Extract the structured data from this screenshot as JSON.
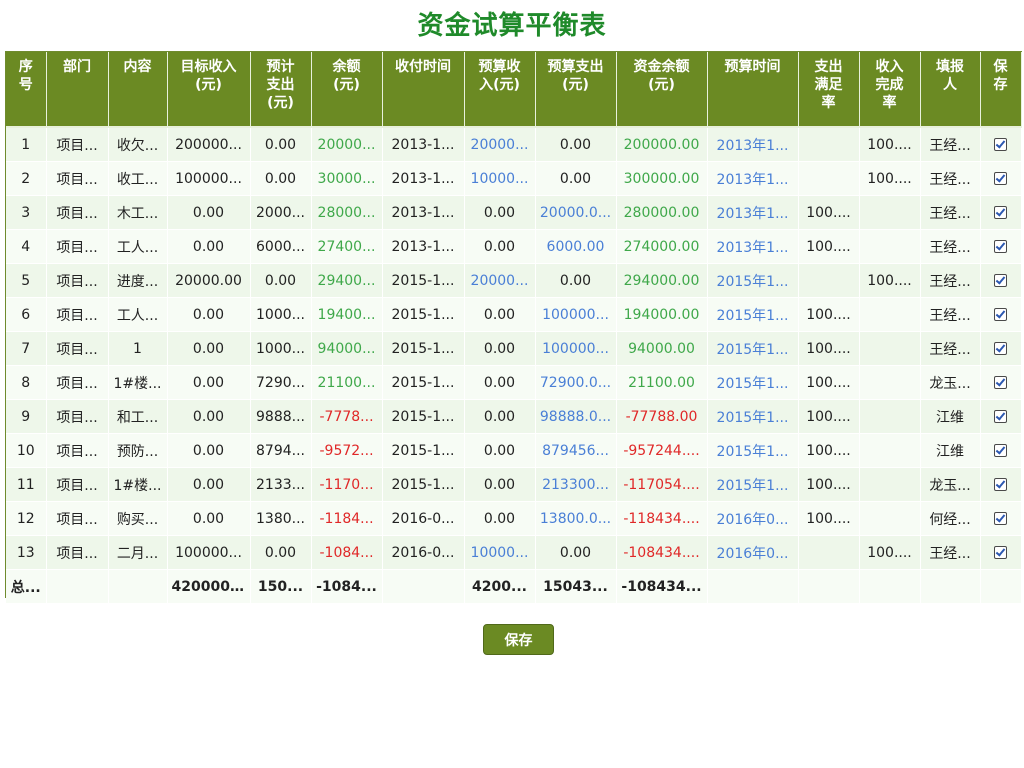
{
  "page": {
    "title": "资金试算平衡表"
  },
  "headers": [
    "序号",
    "部门",
    "内容",
    "目标收入(元)",
    "预计支出(元)",
    "余额(元)",
    "收付时间",
    "预算收入(元)",
    "预算支出(元)",
    "资金余额(元)",
    "预算时间",
    "支出满足率",
    "收入完成率",
    "填报人",
    "保存"
  ],
  "header_lines": [
    [
      "序",
      "号"
    ],
    [
      "部门"
    ],
    [
      "内容"
    ],
    [
      "目标收入",
      "(元)"
    ],
    [
      "预计",
      "支出",
      "(元)"
    ],
    [
      "余额",
      "(元)"
    ],
    [
      "收付时间"
    ],
    [
      "预算收",
      "入(元)"
    ],
    [
      "预算支出",
      "(元)"
    ],
    [
      "资金余额",
      "(元)"
    ],
    [
      "预算时间"
    ],
    [
      "支出",
      "满足",
      "率"
    ],
    [
      "收入",
      "完成",
      "率"
    ],
    [
      "填报",
      "人"
    ],
    [
      "保",
      "存"
    ]
  ],
  "rows": [
    {
      "no": "1",
      "dept": "项目...",
      "content": "收欠...",
      "target_income": "200000...",
      "est_expense": "0.00",
      "balance": "20000...",
      "balance_color": "green",
      "pay_time": "2013-1...",
      "budget_income": "20000...",
      "budget_expense": "0.00",
      "fund_balance": "200000.00",
      "fund_color": "green",
      "budget_time": "2013年1...",
      "expense_rate": "",
      "income_rate": "100....",
      "reporter": "王经...",
      "saved": true
    },
    {
      "no": "2",
      "dept": "项目...",
      "content": "收工...",
      "target_income": "100000...",
      "est_expense": "0.00",
      "balance": "30000...",
      "balance_color": "green",
      "pay_time": "2013-1...",
      "budget_income": "10000...",
      "budget_expense": "0.00",
      "fund_balance": "300000.00",
      "fund_color": "green",
      "budget_time": "2013年1...",
      "expense_rate": "",
      "income_rate": "100....",
      "reporter": "王经...",
      "saved": true
    },
    {
      "no": "3",
      "dept": "项目...",
      "content": "木工...",
      "target_income": "0.00",
      "est_expense": "2000...",
      "balance": "28000...",
      "balance_color": "green",
      "pay_time": "2013-1...",
      "budget_income": "0.00",
      "budget_expense": "20000.0...",
      "fund_balance": "280000.00",
      "fund_color": "green",
      "budget_time": "2013年1...",
      "expense_rate": "100....",
      "income_rate": "",
      "reporter": "王经...",
      "saved": true
    },
    {
      "no": "4",
      "dept": "项目...",
      "content": "工人...",
      "target_income": "0.00",
      "est_expense": "6000...",
      "balance": "27400...",
      "balance_color": "green",
      "pay_time": "2013-1...",
      "budget_income": "0.00",
      "budget_expense": "6000.00",
      "fund_balance": "274000.00",
      "fund_color": "green",
      "budget_time": "2013年1...",
      "expense_rate": "100....",
      "income_rate": "",
      "reporter": "王经...",
      "saved": true
    },
    {
      "no": "5",
      "dept": "项目...",
      "content": "进度...",
      "target_income": "20000.00",
      "est_expense": "0.00",
      "balance": "29400...",
      "balance_color": "green",
      "pay_time": "2015-1...",
      "budget_income": "20000...",
      "budget_expense": "0.00",
      "fund_balance": "294000.00",
      "fund_color": "green",
      "budget_time": "2015年1...",
      "expense_rate": "",
      "income_rate": "100....",
      "reporter": "王经...",
      "saved": true
    },
    {
      "no": "6",
      "dept": "项目...",
      "content": "工人...",
      "target_income": "0.00",
      "est_expense": "1000...",
      "balance": "19400...",
      "balance_color": "green",
      "pay_time": "2015-1...",
      "budget_income": "0.00",
      "budget_expense": "100000...",
      "fund_balance": "194000.00",
      "fund_color": "green",
      "budget_time": "2015年1...",
      "expense_rate": "100....",
      "income_rate": "",
      "reporter": "王经...",
      "saved": true
    },
    {
      "no": "7",
      "dept": "项目...",
      "content": "1",
      "target_income": "0.00",
      "est_expense": "1000...",
      "balance": "94000...",
      "balance_color": "green",
      "pay_time": "2015-1...",
      "budget_income": "0.00",
      "budget_expense": "100000...",
      "fund_balance": "94000.00",
      "fund_color": "green",
      "budget_time": "2015年1...",
      "expense_rate": "100....",
      "income_rate": "",
      "reporter": "王经...",
      "saved": true
    },
    {
      "no": "8",
      "dept": "项目...",
      "content": "1#楼...",
      "target_income": "0.00",
      "est_expense": "7290...",
      "balance": "21100...",
      "balance_color": "green",
      "pay_time": "2015-1...",
      "budget_income": "0.00",
      "budget_expense": "72900.0...",
      "fund_balance": "21100.00",
      "fund_color": "green",
      "budget_time": "2015年1...",
      "expense_rate": "100....",
      "income_rate": "",
      "reporter": "龙玉...",
      "saved": true
    },
    {
      "no": "9",
      "dept": "项目...",
      "content": "和工...",
      "target_income": "0.00",
      "est_expense": "9888...",
      "balance": "-7778...",
      "balance_color": "red",
      "pay_time": "2015-1...",
      "budget_income": "0.00",
      "budget_expense": "98888.0...",
      "fund_balance": "-77788.00",
      "fund_color": "red",
      "budget_time": "2015年1...",
      "expense_rate": "100....",
      "income_rate": "",
      "reporter": "江维",
      "saved": true
    },
    {
      "no": "10",
      "dept": "项目...",
      "content": "预防...",
      "target_income": "0.00",
      "est_expense": "8794...",
      "balance": "-9572...",
      "balance_color": "red",
      "pay_time": "2015-1...",
      "budget_income": "0.00",
      "budget_expense": "879456...",
      "fund_balance": "-957244....",
      "fund_color": "red",
      "budget_time": "2015年1...",
      "expense_rate": "100....",
      "income_rate": "",
      "reporter": "江维",
      "saved": true
    },
    {
      "no": "11",
      "dept": "项目...",
      "content": "1#楼...",
      "target_income": "0.00",
      "est_expense": "2133...",
      "balance": "-1170...",
      "balance_color": "red",
      "pay_time": "2015-1...",
      "budget_income": "0.00",
      "budget_expense": "213300...",
      "fund_balance": "-117054....",
      "fund_color": "red",
      "budget_time": "2015年1...",
      "expense_rate": "100....",
      "income_rate": "",
      "reporter": "龙玉...",
      "saved": true
    },
    {
      "no": "12",
      "dept": "项目...",
      "content": "购买...",
      "target_income": "0.00",
      "est_expense": "1380...",
      "balance": "-1184...",
      "balance_color": "red",
      "pay_time": "2016-0...",
      "budget_income": "0.00",
      "budget_expense": "13800.0...",
      "fund_balance": "-118434....",
      "fund_color": "red",
      "budget_time": "2016年0...",
      "expense_rate": "100....",
      "income_rate": "",
      "reporter": "何经...",
      "saved": true
    },
    {
      "no": "13",
      "dept": "项目...",
      "content": "二月...",
      "target_income": "100000...",
      "est_expense": "0.00",
      "balance": "-1084...",
      "balance_color": "red",
      "pay_time": "2016-0...",
      "budget_income": "10000...",
      "budget_expense": "0.00",
      "fund_balance": "-108434....",
      "fund_color": "red",
      "budget_time": "2016年0...",
      "expense_rate": "",
      "income_rate": "100....",
      "reporter": "王经...",
      "saved": true
    }
  ],
  "total": {
    "label": "总...",
    "target_income": "420000...",
    "est_expense": "150...",
    "balance": "-1084...",
    "budget_income": "4200...",
    "budget_expense": "15043...",
    "fund_balance": "-108434..."
  },
  "buttons": {
    "save_label": "保存"
  },
  "colors": {
    "header_bg": "#6b8a23",
    "title": "#1f8a2a",
    "positive": "#3fa84a",
    "link_blue": "#4a7fd6",
    "negative": "#e02828"
  }
}
